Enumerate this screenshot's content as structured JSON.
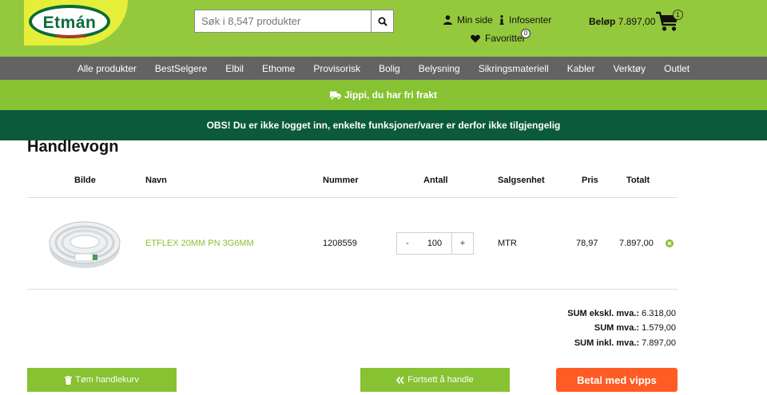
{
  "header": {
    "logo_text": "Etmán",
    "search_placeholder": "Søk i 8,547 produkter",
    "my_page": "Min side",
    "info_center": "Infosenter",
    "favorites": "Favoritter",
    "favorites_count": "0",
    "amount_label": "Beløp",
    "amount_value": "7.897,00",
    "cart_count": "1"
  },
  "nav": {
    "items": [
      "Alle produkter",
      "BestSelgere",
      "Elbil",
      "Ethome",
      "Provisorisk",
      "Bolig",
      "Belysning",
      "Sikringsmateriell",
      "Kabler",
      "Verktøy",
      "Outlet"
    ]
  },
  "banners": {
    "shipping": "Jippi, du har fri frakt",
    "login_notice": "OBS! Du er ikke logget inn, enkelte funksjoner/varer er derfor ikke tilgjengelig"
  },
  "cart": {
    "title": "Handlevogn",
    "columns": [
      "Bilde",
      "Navn",
      "Nummer",
      "Antall",
      "Salgsenhet",
      "Pris",
      "Totalt"
    ],
    "items": [
      {
        "name": "ETFLEX 20MM PN 3G6MM",
        "number": "1208559",
        "qty_minus": "-",
        "qty": "100",
        "qty_plus": "+",
        "unit": "MTR",
        "price": "78,97",
        "total": "7.897,00"
      }
    ],
    "sums": {
      "ex_vat_label": "SUM ekskl. mva.:",
      "ex_vat_value": "6.318,00",
      "vat_label": "SUM mva.:",
      "vat_value": "1.579,00",
      "inc_vat_label": "SUM inkl. mva.:",
      "inc_vat_value": "7.897,00"
    },
    "buttons": {
      "empty": "Tøm handlekurv",
      "continue": "Fortsett å handle",
      "vipps": "Betal med vipps"
    }
  },
  "colors": {
    "header_green": "#95c93d",
    "nav_gray": "#636363",
    "banner_green": "#86c232",
    "banner_dark": "#0b5a3c",
    "vipps_orange": "#ff5b24"
  }
}
